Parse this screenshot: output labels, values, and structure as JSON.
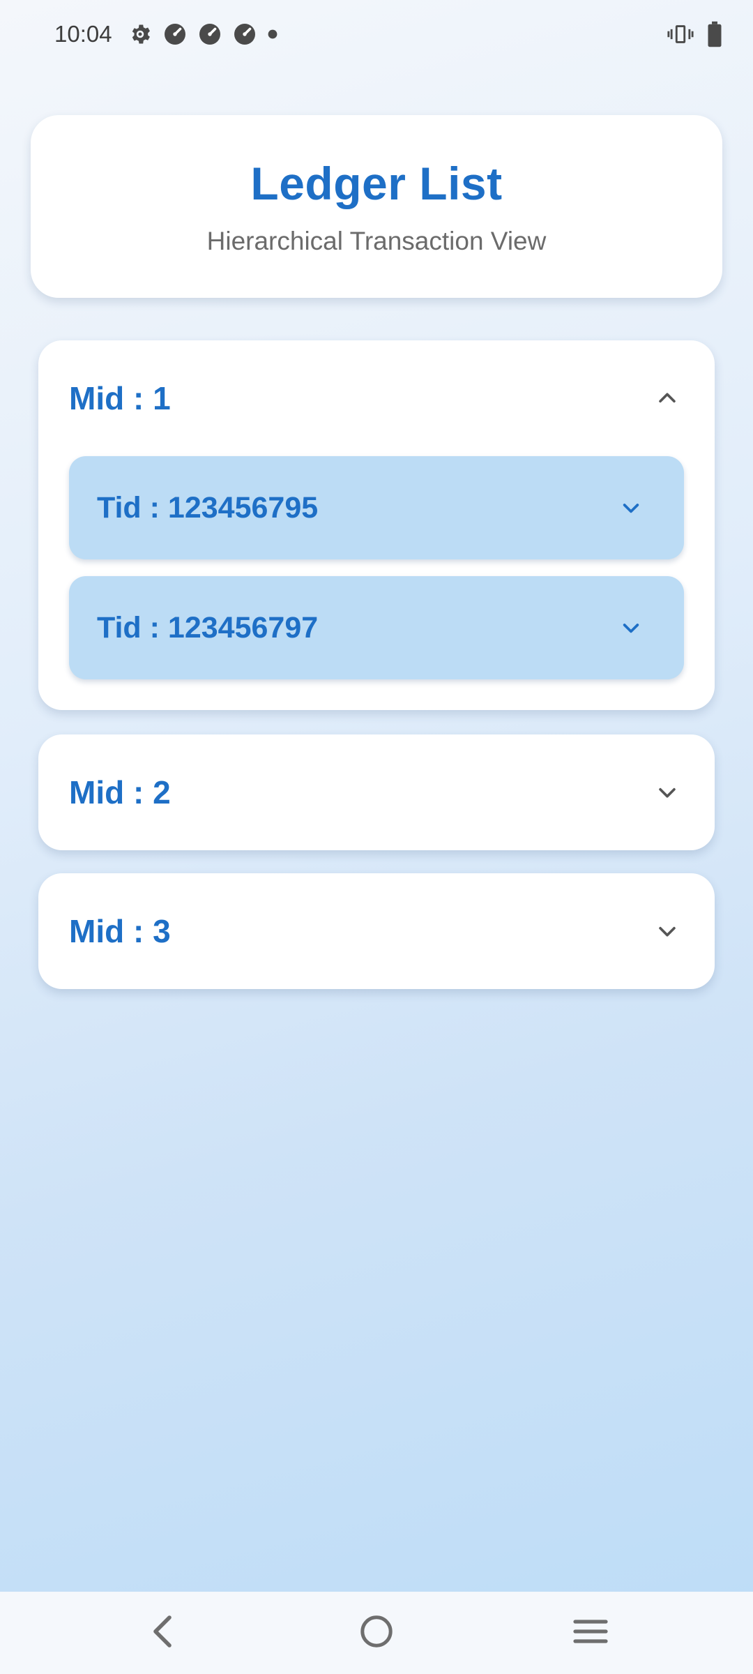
{
  "status_bar": {
    "time": "10:04",
    "icons_left": [
      "settings-gear-icon",
      "speedometer-icon",
      "speedometer-icon",
      "speedometer-icon",
      "dot-icon"
    ],
    "icons_right": [
      "vibrate-icon",
      "battery-icon"
    ]
  },
  "header": {
    "title": "Ledger List",
    "subtitle": "Hierarchical Transaction View"
  },
  "mids": [
    {
      "label": "Mid : 1",
      "expanded": true,
      "tids": [
        {
          "label": "Tid : 123456795",
          "expanded": false
        },
        {
          "label": "Tid : 123456797",
          "expanded": false
        }
      ]
    },
    {
      "label": "Mid : 2",
      "expanded": false,
      "tids": []
    },
    {
      "label": "Mid : 3",
      "expanded": false,
      "tids": []
    }
  ],
  "nav": {
    "items": [
      "back-icon",
      "home-icon",
      "recents-menu-icon"
    ]
  },
  "colors": {
    "accent": "#1e6fc6",
    "tid_background": "#bcdcf5",
    "card_background": "#ffffff",
    "subtitle": "#6b6b6b"
  }
}
